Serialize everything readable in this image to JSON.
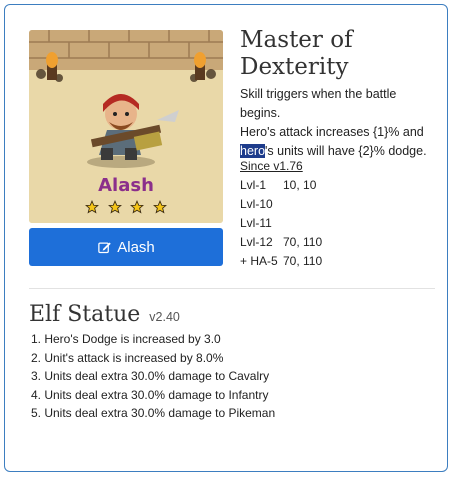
{
  "hero": {
    "name": "Alash",
    "stars": 4,
    "button_label": "Alash"
  },
  "skill": {
    "title_line1": "Master of",
    "title_line2": "Dexterity",
    "desc_line1": "Skill triggers when the battle begins.",
    "desc_line2": "Hero's attack increases {1}% and",
    "desc_line3_highlight": "hero",
    "desc_line3_rest": "'s units will have {2}% dodge.",
    "since": "Since v1.76",
    "levels": [
      {
        "label": "Lvl-1",
        "value": "10, 10"
      },
      {
        "label": "Lvl-10",
        "value": ""
      },
      {
        "label": "Lvl-11",
        "value": ""
      },
      {
        "label": "Lvl-12",
        "value": "70, 110"
      },
      {
        "label": "+ HA-5",
        "value": "70, 110"
      }
    ]
  },
  "statue": {
    "title": "Elf Statue",
    "version": "v2.40",
    "effects": [
      "1. Hero's Dodge is increased by 3.0",
      "2. Unit's attack is increased by 8.0%",
      "3. Units deal extra 30.0% damage to Cavalry",
      "4. Units deal extra 30.0% damage to Infantry",
      "5. Units deal extra 30.0% damage to Pikeman"
    ]
  },
  "colors": {
    "accent": "#1e6fd9",
    "card_border": "#3d7ec0",
    "hero_name": "#8b2f8b",
    "star": "#f5c518",
    "highlight": "#1e3c8c"
  },
  "icons": {
    "button_icon": "edit-icon",
    "rating_icon": "star-icon"
  }
}
